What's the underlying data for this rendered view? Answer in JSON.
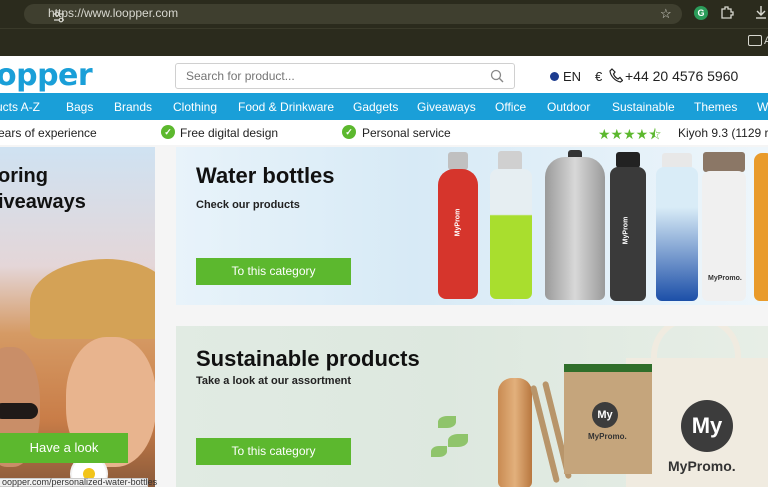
{
  "browser": {
    "url": "https://www.loopper.com",
    "bookmark_text": "A"
  },
  "site": {
    "logo": "opper",
    "search_placeholder": "Search for product...",
    "language": "EN",
    "currency": "€",
    "phone": "+44 20 4576 5960"
  },
  "nav": [
    {
      "label": "ucts A-Z"
    },
    {
      "label": "Bags"
    },
    {
      "label": "Brands"
    },
    {
      "label": "Clothing"
    },
    {
      "label": "Food & Drinkware"
    },
    {
      "label": "Gadgets"
    },
    {
      "label": "Giveaways"
    },
    {
      "label": "Office"
    },
    {
      "label": "Outdoor"
    },
    {
      "label": "Sustainable"
    },
    {
      "label": "Themes"
    },
    {
      "label": "W"
    }
  ],
  "usp": {
    "items": [
      {
        "label": "ears of experience"
      },
      {
        "label": "Free digital design"
      },
      {
        "label": "Personal service"
      }
    ],
    "rating_stars": 4.5,
    "rating_text": "Kiyoh 9.3 (1129 re"
  },
  "promo": {
    "title": "oring\niveaways",
    "button_label": "Have a look"
  },
  "cards": [
    {
      "title": "Water bottles",
      "subtitle": "Check our products",
      "button_label": "To this category"
    },
    {
      "title": "Sustainable products",
      "subtitle": "Take a look at our assortment",
      "button_label": "To this category"
    }
  ],
  "product_branding": {
    "logo_text": "My",
    "brand_text": "MyPromo.",
    "brand_text_short": "MyProm"
  },
  "status_bar": "oopper.com/personalized-water-bottles",
  "colors": {
    "accent_blue": "#1a9fd8",
    "accent_green": "#5cb82e"
  }
}
